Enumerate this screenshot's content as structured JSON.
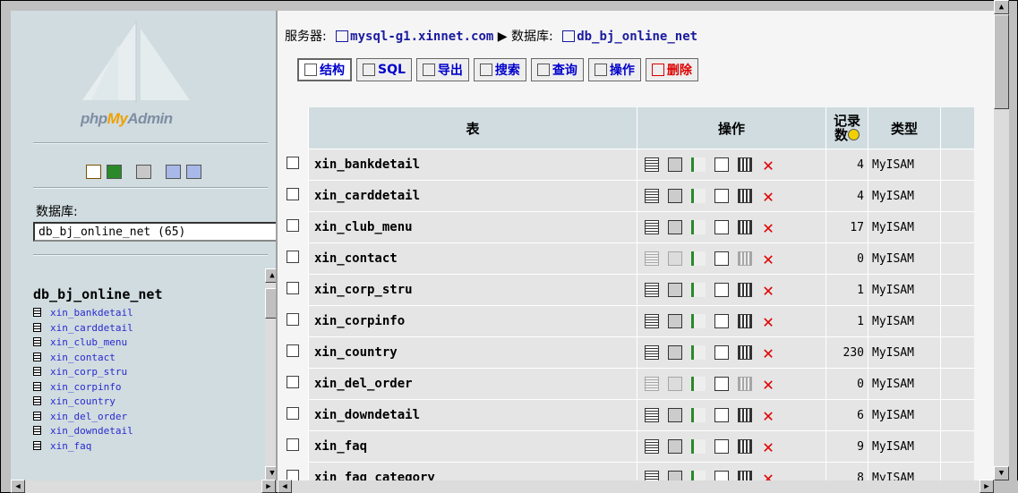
{
  "left": {
    "logo_text_pre": "php",
    "logo_text_my": "My",
    "logo_text_post": "Admin",
    "db_label": "数据库:",
    "db_select_value": "db_bj_online_net (65)",
    "tree_title": "db_bj_online_net",
    "tree_items": [
      "xin_bankdetail",
      "xin_carddetail",
      "xin_club_menu",
      "xin_contact",
      "xin_corp_stru",
      "xin_corpinfo",
      "xin_country",
      "xin_del_order",
      "xin_downdetail",
      "xin_faq"
    ]
  },
  "header": {
    "server_label": "服务器:",
    "server_value": "mysql-g1.xinnet.com",
    "arrow": "▶",
    "db_label": "数据库:",
    "db_value": "db_bj_online_net"
  },
  "tabs": [
    {
      "label": "结构",
      "icon": "structure-icon"
    },
    {
      "label": "SQL",
      "icon": "sql-icon"
    },
    {
      "label": "导出",
      "icon": "export-icon"
    },
    {
      "label": "搜索",
      "icon": "search-icon"
    },
    {
      "label": "查询",
      "icon": "query-icon"
    },
    {
      "label": "操作",
      "icon": "operations-icon"
    },
    {
      "label": "删除",
      "icon": "drop-icon"
    }
  ],
  "table": {
    "headers": {
      "table": "表",
      "ops": "操作",
      "records": "记录数",
      "type": "类型"
    },
    "rows": [
      {
        "name": "xin_bankdetail",
        "records": "4",
        "type": "MyISAM",
        "empty": false
      },
      {
        "name": "xin_carddetail",
        "records": "4",
        "type": "MyISAM",
        "empty": false
      },
      {
        "name": "xin_club_menu",
        "records": "17",
        "type": "MyISAM",
        "empty": false
      },
      {
        "name": "xin_contact",
        "records": "0",
        "type": "MyISAM",
        "empty": true
      },
      {
        "name": "xin_corp_stru",
        "records": "1",
        "type": "MyISAM",
        "empty": false
      },
      {
        "name": "xin_corpinfo",
        "records": "1",
        "type": "MyISAM",
        "empty": false
      },
      {
        "name": "xin_country",
        "records": "230",
        "type": "MyISAM",
        "empty": false
      },
      {
        "name": "xin_del_order",
        "records": "0",
        "type": "MyISAM",
        "empty": true
      },
      {
        "name": "xin_downdetail",
        "records": "6",
        "type": "MyISAM",
        "empty": false
      },
      {
        "name": "xin_faq",
        "records": "9",
        "type": "MyISAM",
        "empty": false
      },
      {
        "name": "xin_faq_category",
        "records": "8",
        "type": "MyISAM",
        "empty": false
      }
    ]
  },
  "colors": {
    "header_bg": "#d0dce0",
    "row_bg": "#e5e5e5",
    "link": "#0000cc",
    "drop": "#e00000"
  }
}
